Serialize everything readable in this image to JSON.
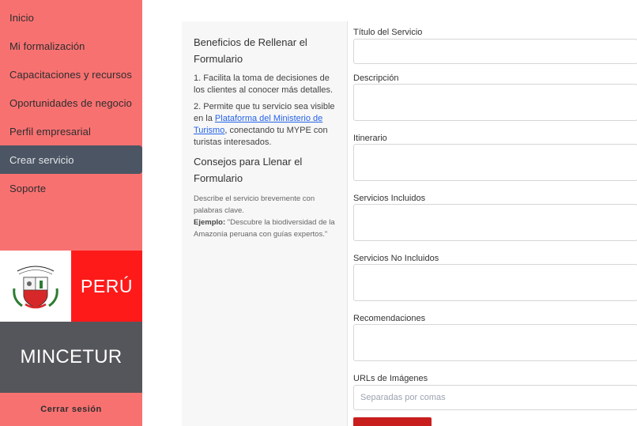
{
  "sidebar": {
    "items": [
      {
        "label": "Inicio"
      },
      {
        "label": "Mi formalización"
      },
      {
        "label": "Capacitaciones y recursos"
      },
      {
        "label": "Oportunidades de negocio"
      },
      {
        "label": "Perfil empresarial"
      },
      {
        "label": "Crear servicio",
        "active": true
      },
      {
        "label": "Soporte"
      }
    ],
    "logo_peru": "PERÚ",
    "logo_org": "MINCETUR",
    "logout_label": "Cerrar sesión"
  },
  "info": {
    "heading1": "Beneficios de Rellenar el Formulario",
    "benefit1": "1. Facilita la toma de decisiones de los clientes al conocer más detalles.",
    "benefit2_prefix": "2. Permite que tu servicio sea visible en la ",
    "benefit2_link": "Plataforma del Ministerio de Turismo",
    "benefit2_suffix": ", conectando tu MYPE con turistas interesados.",
    "heading2": "Consejos para Llenar el Formulario",
    "tip_text": "Describe el servicio brevemente con palabras clave.",
    "tip_example_label": "Ejemplo:",
    "tip_example_text": " \"Descubre la biodiversidad de la Amazonía peruana con guías expertos.\""
  },
  "form": {
    "title_label": "Título del Servicio",
    "description_label": "Descripción",
    "itinerary_label": "Itinerario",
    "included_label": "Servicios Incluidos",
    "not_included_label": "Servicios No Incluidos",
    "recommendations_label": "Recomendaciones",
    "images_label": "URLs de Imágenes",
    "images_placeholder": "Separadas por comas"
  },
  "colors": {
    "sidebar_bg": "#f87171",
    "active_item_bg": "#4b5563",
    "peru_red": "#ff1a1a",
    "mincetur_gray": "#55565b",
    "submit_red": "#c81e1e",
    "link_blue": "#2563eb"
  }
}
